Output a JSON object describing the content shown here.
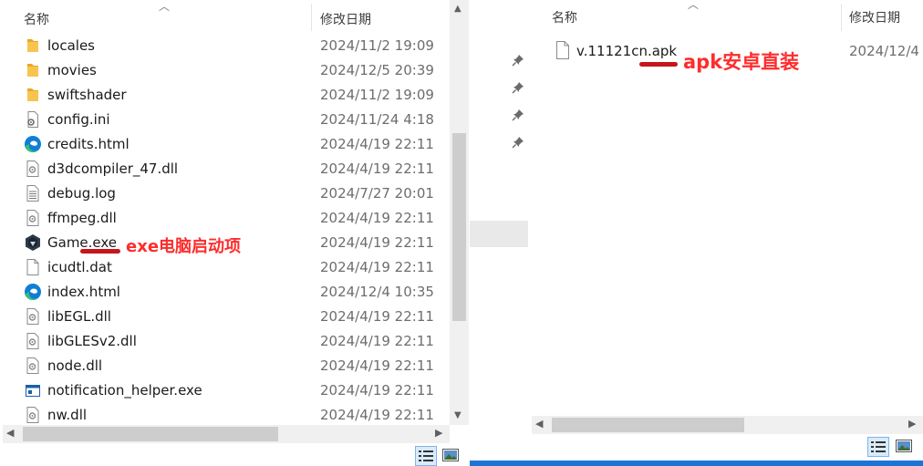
{
  "left_explorer": {
    "columns": {
      "name": "名称",
      "date_modified": "修改日期"
    },
    "files": [
      {
        "name": "locales",
        "date": "2024/11/2 19:09",
        "icon": "folder-icon"
      },
      {
        "name": "movies",
        "date": "2024/12/5 20:39",
        "icon": "folder-icon"
      },
      {
        "name": "swiftshader",
        "date": "2024/11/2 19:09",
        "icon": "folder-icon"
      },
      {
        "name": "config.ini",
        "date": "2024/11/24 4:18",
        "icon": "settings-file-icon"
      },
      {
        "name": "credits.html",
        "date": "2024/4/19 22:11",
        "icon": "edge-browser-icon"
      },
      {
        "name": "d3dcompiler_47.dll",
        "date": "2024/4/19 22:11",
        "icon": "dll-file-icon"
      },
      {
        "name": "debug.log",
        "date": "2024/7/27 20:01",
        "icon": "text-file-icon"
      },
      {
        "name": "ffmpeg.dll",
        "date": "2024/4/19 22:11",
        "icon": "dll-file-icon"
      },
      {
        "name": "Game.exe",
        "date": "2024/4/19 22:11",
        "icon": "game-app-icon"
      },
      {
        "name": "icudtl.dat",
        "date": "2024/4/19 22:11",
        "icon": "blank-file-icon"
      },
      {
        "name": "index.html",
        "date": "2024/12/4 10:35",
        "icon": "edge-browser-icon"
      },
      {
        "name": "libEGL.dll",
        "date": "2024/4/19 22:11",
        "icon": "dll-file-icon"
      },
      {
        "name": "libGLESv2.dll",
        "date": "2024/4/19 22:11",
        "icon": "dll-file-icon"
      },
      {
        "name": "node.dll",
        "date": "2024/4/19 22:11",
        "icon": "dll-file-icon"
      },
      {
        "name": "notification_helper.exe",
        "date": "2024/4/19 22:11",
        "icon": "app-window-icon"
      },
      {
        "name": "nw.dll",
        "date": "2024/4/19 22:11",
        "icon": "dll-file-icon"
      }
    ],
    "annotation": "exe电脑启动项"
  },
  "right_explorer": {
    "columns": {
      "name": "名称",
      "date_modified": "修改日期"
    },
    "files": [
      {
        "name": "v.11121cn.apk",
        "date": "2024/12/4",
        "icon": "blank-file-icon"
      }
    ],
    "annotation": "apk安卓直装"
  },
  "colors": {
    "annotation_red": "#ff2c2c",
    "underline_red": "#c4161c",
    "folder_yellow": "#f8c44f",
    "edge_blue": "#0f7fd6",
    "edge_green": "#35c46b",
    "accent_blue": "#1e74d6"
  }
}
